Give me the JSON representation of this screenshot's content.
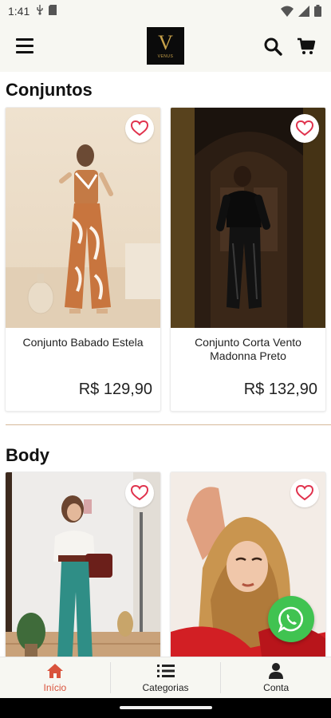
{
  "status_bar": {
    "time": "1:41"
  },
  "app_bar": {
    "logo_letter": "V",
    "logo_sub": "VENUS"
  },
  "sections": [
    {
      "title": "Conjuntos",
      "products": [
        {
          "name": "Conjunto Babado Estela",
          "price": "R$  129,90"
        },
        {
          "name": "Conjunto Corta Vento Madonna Preto",
          "price": "R$  132,90"
        }
      ]
    },
    {
      "title": "Body",
      "products": [
        {
          "name": "",
          "price": ""
        },
        {
          "name": "",
          "price": ""
        }
      ]
    }
  ],
  "bottom_nav": [
    {
      "label": "Início",
      "icon": "home-icon",
      "active": true
    },
    {
      "label": "Categorias",
      "icon": "list-icon",
      "active": false
    },
    {
      "label": "Conta",
      "icon": "person-icon",
      "active": false
    }
  ],
  "colors": {
    "accent": "#d9533c",
    "heart": "#e0324d",
    "whatsapp": "#40c351",
    "logo_gold": "#c8a24a"
  }
}
